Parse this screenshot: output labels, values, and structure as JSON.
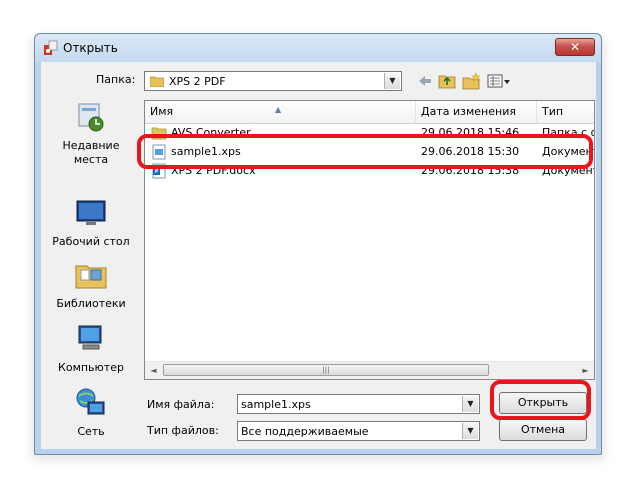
{
  "window": {
    "title": "Открыть",
    "close_label": "✕"
  },
  "toolbar": {
    "folder_label": "Папка:",
    "folder_value": "XPS 2 PDF"
  },
  "places": [
    {
      "label": "Недавние места",
      "icon": "recent-places-icon"
    },
    {
      "label": "Рабочий стол",
      "icon": "desktop-icon"
    },
    {
      "label": "Библиотеки",
      "icon": "libraries-icon"
    },
    {
      "label": "Компьютер",
      "icon": "computer-icon"
    },
    {
      "label": "Сеть",
      "icon": "network-icon"
    }
  ],
  "filelist": {
    "columns": [
      "Имя",
      "Дата изменения",
      "Тип"
    ],
    "rows": [
      {
        "name": "AVS Converter",
        "date": "29.06.2018 15:46",
        "type": "Папка с ф",
        "icon": "folder-icon"
      },
      {
        "name": "sample1.xps",
        "date": "29.06.2018 15:30",
        "type": "Документ",
        "icon": "xps-file-icon"
      },
      {
        "name": "XPS 2 PDF.docx",
        "date": "29.06.2018 15:38",
        "type": "Документ",
        "icon": "docx-file-icon"
      }
    ]
  },
  "bottom": {
    "filename_label": "Имя файла:",
    "filename_value": "sample1.xps",
    "filetype_label": "Тип файлов:",
    "filetype_value": "Все поддерживаемые",
    "open_button": "Открыть",
    "cancel_button": "Отмена"
  },
  "colors": {
    "highlight": "#e8151b",
    "close_button": "#c75050"
  }
}
